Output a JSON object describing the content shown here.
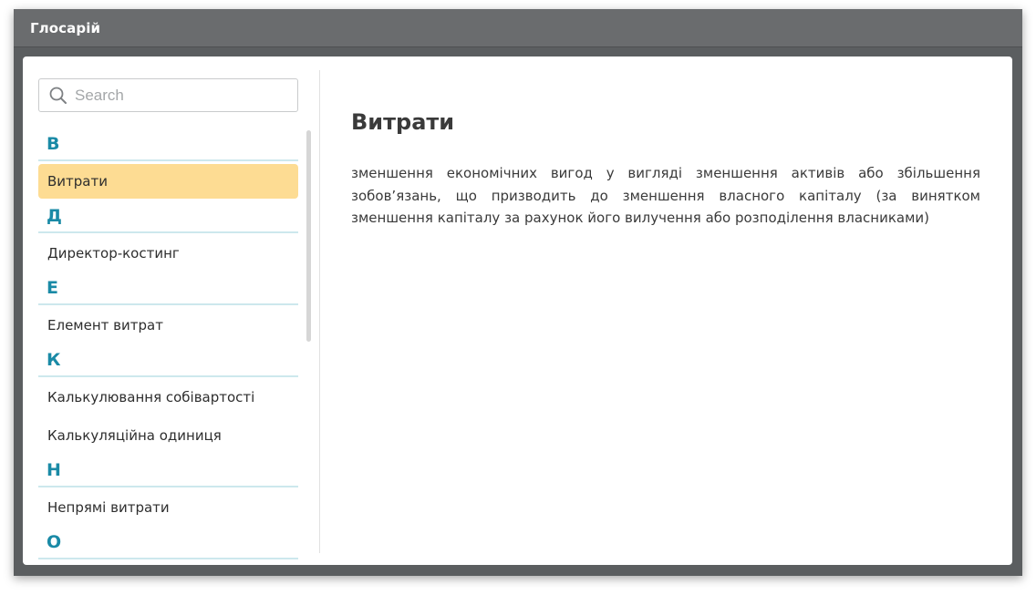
{
  "window": {
    "title": "Глосарій"
  },
  "search": {
    "placeholder": "Search",
    "value": ""
  },
  "sidebar": {
    "groups": [
      {
        "letter": "В",
        "terms": [
          "Витрати"
        ]
      },
      {
        "letter": "Д",
        "terms": [
          "Директор-костинг"
        ]
      },
      {
        "letter": "Е",
        "terms": [
          "Елемент витрат"
        ]
      },
      {
        "letter": "К",
        "terms": [
          "Калькулювання собівартості",
          "Калькуляційна одиниця"
        ]
      },
      {
        "letter": "Н",
        "terms": [
          "Непрямі витрати"
        ]
      },
      {
        "letter": "О",
        "terms": []
      }
    ],
    "selected_term": "Витрати"
  },
  "detail": {
    "title": "Витрати",
    "definition": "зменшення економічних вигод у вигляді зменшення активів або збільшення зобов’язань, що призводить до зменшення власного капіталу (за винятком зменшення капіталу за рахунок його вилучення або розподілення власниками)"
  },
  "colors": {
    "titlebar": "#6a6c6e",
    "letter_accent": "#1a8aa6",
    "letter_underline": "#cde8ed",
    "selected_background": "#fddc93"
  },
  "icons": {
    "search": "search-icon"
  }
}
